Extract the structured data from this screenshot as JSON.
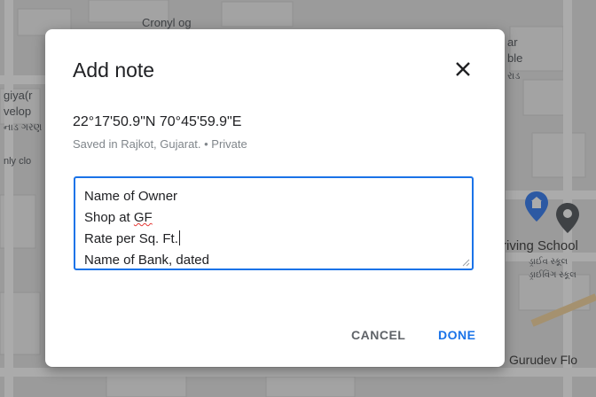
{
  "map": {
    "labels": {
      "top_label": "Cronyl og",
      "left_label_1": "giya(r",
      "left_label_2": "velop",
      "left_label_3": "નાડ ગરણ",
      "left_label_4": "nly clo",
      "right_label_1": "ar",
      "right_label_2": "ble",
      "right_label_3": "રાડ",
      "driving_school": "riving School",
      "driving_school_local1": "ડ્રાઈવ સ્કૂલ",
      "driving_school_local2": "ડ્રાઈવિંગ સ્કૂલ",
      "gurudev": "Gurudev Flo"
    },
    "pin_colors": {
      "blue_pin": "#4285f4",
      "grey_pin": "#5f6368"
    }
  },
  "dialog": {
    "title": "Add note",
    "close_icon": "close-icon",
    "coordinates": "22°17'50.9\"N 70°45'59.9\"E",
    "saved_info": "Saved in Rajkot, Gujarat. • Private",
    "note_lines": {
      "line1": "Name of Owner",
      "line2_prefix": "Shop at ",
      "line2_misspelled": "GF",
      "line3": "Rate per Sq. Ft.",
      "line4": "Name of Bank, dated"
    },
    "cancel_label": "CANCEL",
    "done_label": "DONE"
  },
  "colors": {
    "accent": "#1a73e8",
    "text": "#202124",
    "muted": "#80868b"
  }
}
